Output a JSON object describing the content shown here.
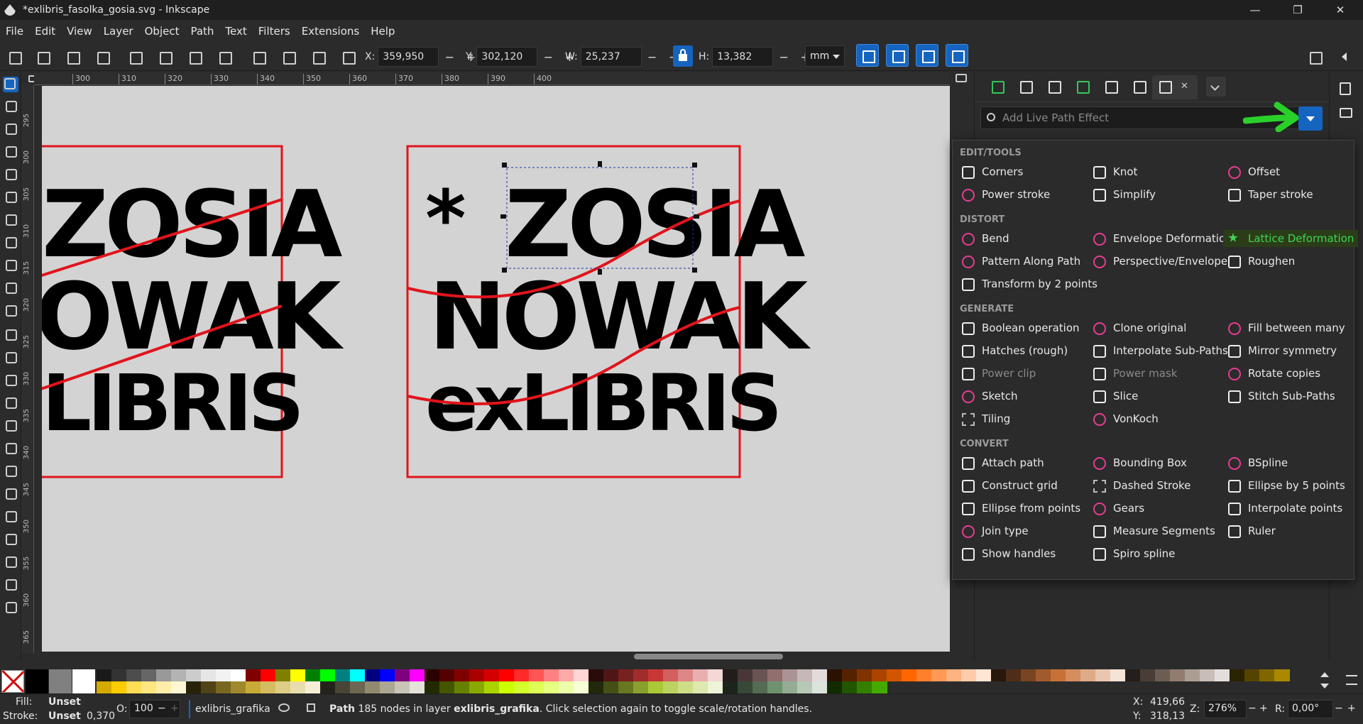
{
  "window": {
    "title": "*exlibris_fasolka_gosia.svg - Inkscape",
    "minimize": "—",
    "maximize": "❐",
    "close": "✕"
  },
  "menu": [
    "File",
    "Edit",
    "View",
    "Layer",
    "Object",
    "Path",
    "Text",
    "Filters",
    "Extensions",
    "Help"
  ],
  "toolbar": {
    "x_label": "X:",
    "x_value": "359,950",
    "y_label": "Y:",
    "y_value": "302,120",
    "w_label": "W:",
    "w_value": "25,237",
    "h_label": "H:",
    "h_value": "13,382",
    "minus": "−",
    "plus": "+",
    "unit": "mm"
  },
  "ruler": {
    "h_ticks": [
      "300",
      "310",
      "320",
      "330",
      "340",
      "350",
      "360",
      "370",
      "380",
      "390",
      "400"
    ],
    "v_ticks": [
      "295",
      "300",
      "305",
      "310",
      "315",
      "320",
      "325",
      "330",
      "335",
      "340",
      "345",
      "350",
      "355",
      "360",
      "365"
    ]
  },
  "artwork": {
    "line1": "ZOSIA",
    "line2": "NOWAK",
    "line3": "exLIBRIS",
    "asterisk": "*",
    "left_line1": "ZOSIA",
    "left_line2": "OWAK",
    "left_line3": "LIBRIS",
    "frame_color": "#e0141c"
  },
  "lpe": {
    "search_placeholder": "Add Live Path Effect",
    "sections": [
      {
        "title": "EDIT/TOOLS",
        "items": [
          {
            "label": "Corners",
            "icon": "corners-icon",
            "style": "w"
          },
          {
            "label": "Knot",
            "icon": "knot-icon",
            "style": "w"
          },
          {
            "label": "Offset",
            "icon": "offset-icon",
            "style": "p"
          },
          {
            "label": "Power stroke",
            "icon": "power-stroke-icon",
            "style": "p"
          },
          {
            "label": "Simplify",
            "icon": "simplify-icon",
            "style": "w"
          },
          {
            "label": "Taper stroke",
            "icon": "taper-stroke-icon",
            "style": "w"
          }
        ]
      },
      {
        "title": "DISTORT",
        "items": [
          {
            "label": "Bend",
            "icon": "bend-icon",
            "style": "p"
          },
          {
            "label": "Envelope Deformation",
            "icon": "envelope-icon",
            "style": "p"
          },
          {
            "label": "Lattice Deformation",
            "icon": "lattice-icon",
            "style": "g",
            "highlight": true
          },
          {
            "label": "Pattern Along Path",
            "icon": "pattern-icon",
            "style": "p"
          },
          {
            "label": "Perspective/Envelope",
            "icon": "perspective-icon",
            "style": "p"
          },
          {
            "label": "Roughen",
            "icon": "roughen-icon",
            "style": "w"
          },
          {
            "label": "Transform by 2 points",
            "icon": "transform-icon",
            "style": "w"
          }
        ]
      },
      {
        "title": "GENERATE",
        "items": [
          {
            "label": "Boolean operation",
            "icon": "boolean-icon",
            "style": "w"
          },
          {
            "label": "Clone original",
            "icon": "clone-icon",
            "style": "p"
          },
          {
            "label": "Fill between many",
            "icon": "fill-between-icon",
            "style": "p"
          },
          {
            "label": "Hatches (rough)",
            "icon": "hatches-icon",
            "style": "w"
          },
          {
            "label": "Interpolate Sub-Paths",
            "icon": "interp-sub-icon",
            "style": "w"
          },
          {
            "label": "Mirror symmetry",
            "icon": "mirror-icon",
            "style": "w"
          },
          {
            "label": "Power clip",
            "icon": "power-clip-icon",
            "style": "w",
            "disabled": true
          },
          {
            "label": "Power mask",
            "icon": "power-mask-icon",
            "style": "w",
            "disabled": true
          },
          {
            "label": "Rotate copies",
            "icon": "rotate-icon",
            "style": "p"
          },
          {
            "label": "Sketch",
            "icon": "sketch-icon",
            "style": "p"
          },
          {
            "label": "Slice",
            "icon": "slice-icon",
            "style": "w"
          },
          {
            "label": "Stitch Sub-Paths",
            "icon": "stitch-icon",
            "style": "w"
          },
          {
            "label": "Tiling",
            "icon": "tiling-icon",
            "style": "d"
          },
          {
            "label": "VonKoch",
            "icon": "vonkoch-icon",
            "style": "p"
          }
        ]
      },
      {
        "title": "CONVERT",
        "items": [
          {
            "label": "Attach path",
            "icon": "attach-icon",
            "style": "w"
          },
          {
            "label": "Bounding Box",
            "icon": "bbox-icon",
            "style": "p"
          },
          {
            "label": "BSpline",
            "icon": "bspline-icon",
            "style": "p"
          },
          {
            "label": "Construct grid",
            "icon": "grid-icon",
            "style": "w"
          },
          {
            "label": "Dashed Stroke",
            "icon": "dashed-icon",
            "style": "d"
          },
          {
            "label": "Ellipse by 5 points",
            "icon": "ellipse5-icon",
            "style": "w"
          },
          {
            "label": "Ellipse from points",
            "icon": "ellipse-pts-icon",
            "style": "w"
          },
          {
            "label": "Gears",
            "icon": "gears-icon",
            "style": "p"
          },
          {
            "label": "Interpolate points",
            "icon": "interp-pts-icon",
            "style": "w"
          },
          {
            "label": "Join type",
            "icon": "join-icon",
            "style": "p"
          },
          {
            "label": "Measure Segments",
            "icon": "measure-icon",
            "style": "w"
          },
          {
            "label": "Ruler",
            "icon": "ruler-icon",
            "style": "w"
          },
          {
            "label": "Show handles",
            "icon": "handles-icon",
            "style": "w"
          },
          {
            "label": "Spiro spline",
            "icon": "spiro-icon",
            "style": "w"
          }
        ]
      }
    ]
  },
  "palette_colors": [
    "#000000",
    "#808080",
    "#ffffff",
    "#1a1a1a",
    "#333333",
    "#4d4d4d",
    "#666666",
    "#999999",
    "#b3b3b3",
    "#cccccc",
    "#e6e6e6",
    "#f2f2f2",
    "#ffffff",
    "#800000",
    "#ff0000",
    "#808000",
    "#ffff00",
    "#008000",
    "#00ff00",
    "#008080",
    "#00ffff",
    "#000080",
    "#0000ff",
    "#800080",
    "#ff00ff",
    "#2b0000",
    "#550000",
    "#800000",
    "#aa0000",
    "#d40000",
    "#ff0000",
    "#ff2a2a",
    "#ff5555",
    "#ff8080",
    "#ffaaaa",
    "#ffd5d5",
    "#280b0b",
    "#501616",
    "#782121",
    "#a02c2c",
    "#c83737",
    "#d35f5f",
    "#de8787",
    "#e9afaf",
    "#f4d7d7",
    "#241c1c",
    "#483737",
    "#6c5353",
    "#916f6f",
    "#ac9393",
    "#c8b7b7",
    "#e3dbdb",
    "#2b1100",
    "#552200",
    "#803300",
    "#aa4400",
    "#d45500",
    "#ff6600",
    "#ff7f2a",
    "#ff9955",
    "#ffb380",
    "#ffccaa",
    "#ffe6d5",
    "#28170b",
    "#502d16",
    "#784421",
    "#a05a2c",
    "#c87137",
    "#d38d5f",
    "#deaa87",
    "#e9c6af",
    "#f4e3d7",
    "#241f1c",
    "#483e37",
    "#6c5d53",
    "#917c6f",
    "#ac9d93",
    "#c8beb7",
    "#e3dedb",
    "#2b2200",
    "#554400",
    "#806600",
    "#aa8800"
  ],
  "palette_colors2": [
    "#d4aa00",
    "#ffcc00",
    "#ffdd55",
    "#ffe680",
    "#ffeeaa",
    "#fff6d5",
    "#28220b",
    "#504416",
    "#786721",
    "#a0892c",
    "#c8ab37",
    "#d3bc5f",
    "#decd87",
    "#e9ddaf",
    "#f4eed7",
    "#24221c",
    "#484537",
    "#6c6753",
    "#918a6f",
    "#aca793",
    "#c8c4b7",
    "#e3e2db",
    "#222b00",
    "#445500",
    "#668000",
    "#88aa00",
    "#aad400",
    "#ccff00",
    "#d4ff2a",
    "#ddff55",
    "#e5ff80",
    "#eeffaa",
    "#f6ffd5",
    "#22280b",
    "#445016",
    "#677821",
    "#89a02c",
    "#abc837",
    "#bcd35f",
    "#cdde87",
    "#dde9af",
    "#eef4d7",
    "#1c241c",
    "#374837",
    "#536c53",
    "#6f916f",
    "#93ac93",
    "#b7c8b7",
    "#dbe3db",
    "#112b00",
    "#225500",
    "#338000",
    "#44aa00"
  ],
  "status": {
    "fill_label": "Fill:",
    "fill_value": "Unset",
    "stroke_label": "Stroke:",
    "stroke_value": "Unset",
    "stroke_width": "0,370",
    "opacity_label": "O:",
    "opacity_value": "100",
    "layer": "exlibris_grafika",
    "msg_bold1": "Path",
    "msg_mid": " 185 nodes in layer ",
    "msg_bold2": "exlibris_grafika",
    "msg_end": ". Click selection again to toggle scale/rotation handles.",
    "cx_label": "X:",
    "cx": "419,66",
    "cy_label": "Y:",
    "cy": "318,13",
    "zoom_label": "Z:",
    "zoom": "276%",
    "rot_label": "R:",
    "rot": "0,00°"
  }
}
